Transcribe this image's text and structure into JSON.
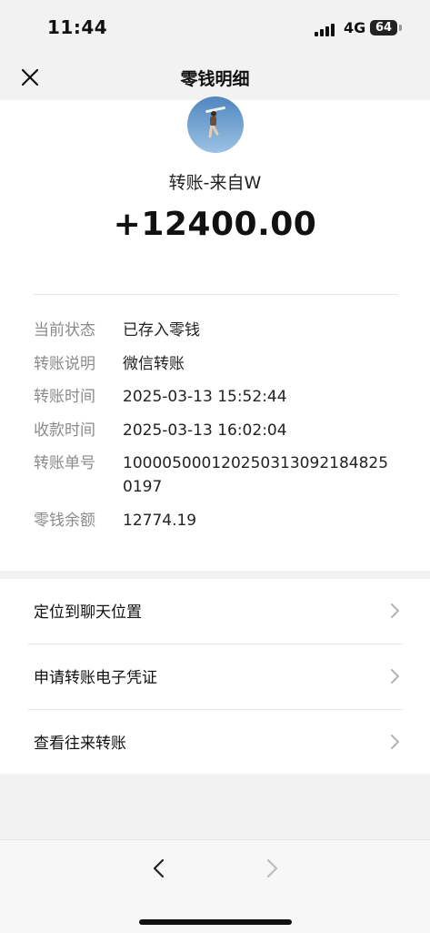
{
  "status": {
    "time": "11:44",
    "network": "4G",
    "battery": "64"
  },
  "nav": {
    "title": "零钱明细",
    "close_icon": "close-icon"
  },
  "transfer": {
    "from": "转账-来自W",
    "amount": "+12400.00",
    "details": [
      {
        "key": "当前状态",
        "value": "已存入零钱"
      },
      {
        "key": "转账说明",
        "value": "微信转账"
      },
      {
        "key": "转账时间",
        "value": "2025-03-13 15:52:44"
      },
      {
        "key": "收款时间",
        "value": "2025-03-13 16:02:04"
      },
      {
        "key": "转账单号",
        "value": "100005000120250313092184825 0197"
      },
      {
        "key": "零钱余额",
        "value": "12774.19"
      }
    ]
  },
  "menu": [
    {
      "label": "定位到聊天位置"
    },
    {
      "label": "申请转账电子凭证"
    },
    {
      "label": "查看往来转账"
    }
  ],
  "bottom_nav": {
    "back_icon": "chevron-left-icon",
    "forward_icon": "chevron-right-icon"
  }
}
